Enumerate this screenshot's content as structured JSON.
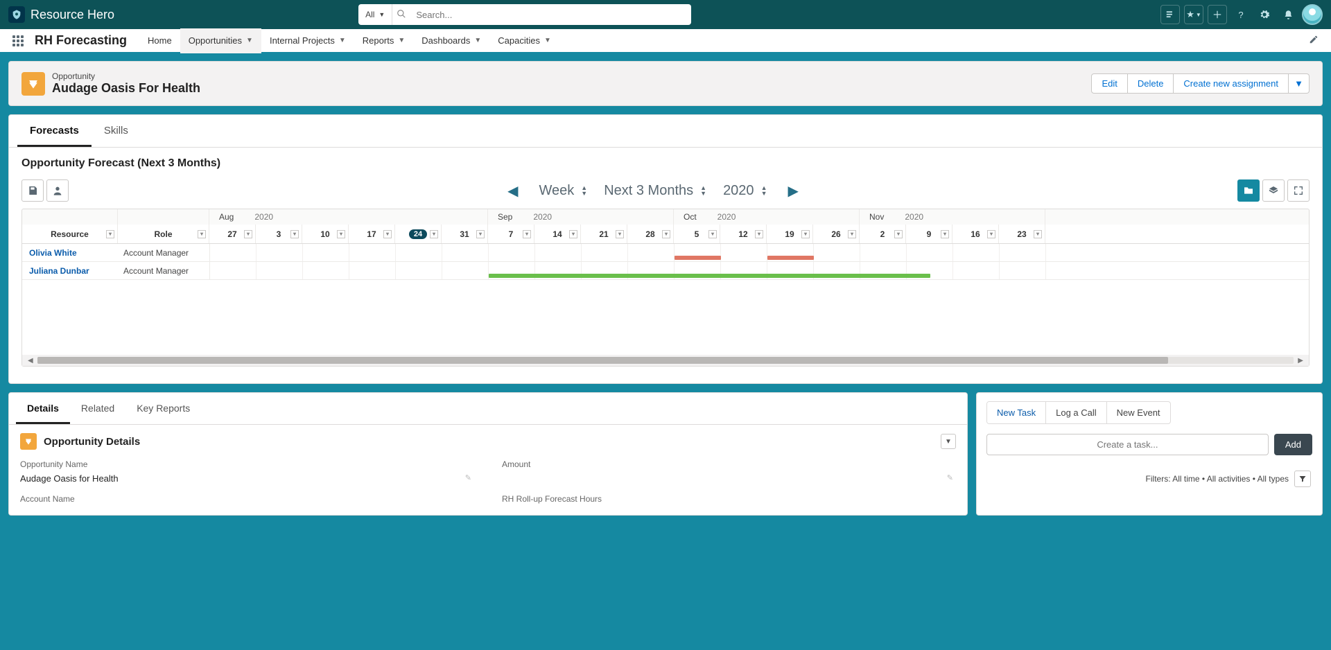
{
  "topbar": {
    "brand": "Resource Hero",
    "search_scope": "All",
    "search_placeholder": "Search..."
  },
  "nav": {
    "appname": "RH Forecasting",
    "items": [
      "Home",
      "Opportunities",
      "Internal Projects",
      "Reports",
      "Dashboards",
      "Capacities"
    ],
    "active_index": 1
  },
  "record": {
    "object_label": "Opportunity",
    "name": "Audage Oasis For Health",
    "actions": {
      "edit": "Edit",
      "delete": "Delete",
      "create": "Create new assignment"
    }
  },
  "tabs_main": {
    "forecasts": "Forecasts",
    "skills": "Skills"
  },
  "forecast": {
    "title": "Opportunity Forecast (Next 3 Months)",
    "view_unit": "Week",
    "range": "Next 3 Months",
    "year": "2020",
    "columns": {
      "resource": "Resource",
      "role": "Role"
    },
    "months": [
      {
        "label_m": "Aug",
        "label_y": "2020"
      },
      {
        "label_m": "Sep",
        "label_y": "2020"
      },
      {
        "label_m": "Oct",
        "label_y": "2020"
      },
      {
        "label_m": "Nov",
        "label_y": "2020"
      }
    ],
    "weeks": [
      "27",
      "3",
      "10",
      "17",
      "24",
      "31",
      "7",
      "14",
      "21",
      "28",
      "5",
      "12",
      "19",
      "26",
      "2",
      "9",
      "16",
      "23"
    ],
    "current_week_index": 4,
    "rows": [
      {
        "name": "Olivia White",
        "role": "Account Manager",
        "bars": [
          {
            "color": "red",
            "start": 10,
            "span": 1
          },
          {
            "color": "red",
            "start": 12,
            "span": 1
          }
        ]
      },
      {
        "name": "Juliana Dunbar",
        "role": "Account Manager",
        "bars": [
          {
            "color": "green",
            "start": 6,
            "span": 9.5
          }
        ]
      }
    ]
  },
  "tabs_detail": {
    "details": "Details",
    "related": "Related",
    "keyreports": "Key Reports"
  },
  "details": {
    "section_title": "Opportunity Details",
    "fields": {
      "opportunity_name_label": "Opportunity Name",
      "opportunity_name_value": "Audage Oasis for Health",
      "account_name_label": "Account Name",
      "amount_label": "Amount",
      "rollup_label": "RH Roll-up Forecast Hours"
    }
  },
  "activity": {
    "tabs": {
      "newtask": "New Task",
      "logcall": "Log a Call",
      "newevent": "New Event"
    },
    "create_placeholder": "Create a task...",
    "add": "Add",
    "filters_label": "Filters: All time • All activities • All types"
  }
}
